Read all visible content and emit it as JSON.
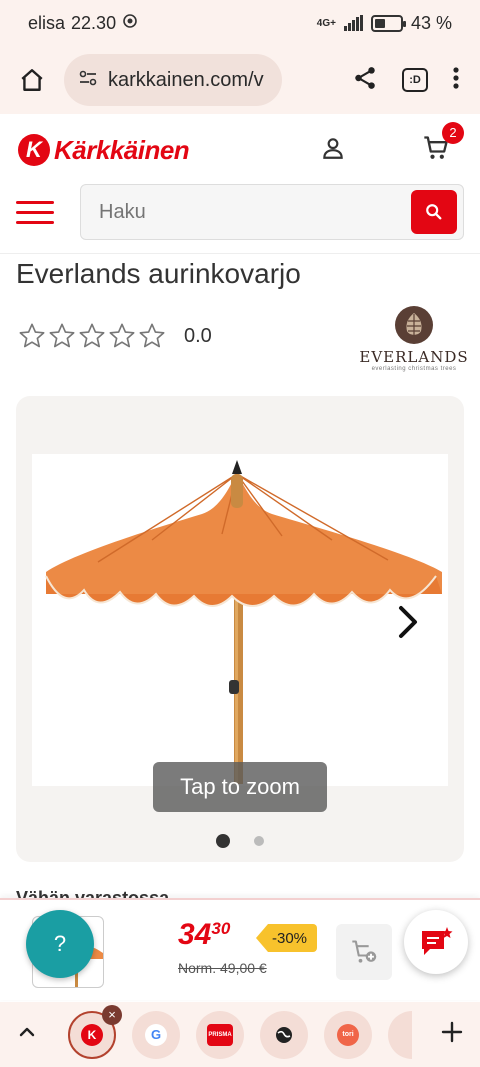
{
  "status_bar": {
    "carrier": "elisa",
    "time": "22.30",
    "network": "4G+",
    "battery_text": "43 %",
    "battery_level": 0.43
  },
  "browser": {
    "url": "karkkainen.com/v",
    "tab_count": ":D"
  },
  "site": {
    "brand_name": "Kärkkäinen",
    "cart_count": "2",
    "search": {
      "placeholder": "Haku"
    },
    "accent_color": "#e30613"
  },
  "product": {
    "title": "Everlands aurinkovarjo",
    "rating_value": "0.0",
    "rating_stars": 0,
    "brand_logo": {
      "name": "EVERLANDS",
      "tagline": "everlasting christmas trees"
    },
    "gallery": {
      "zoom_hint": "Tap to zoom",
      "image_count": 2,
      "active_index": 0
    },
    "peek_text": "Vähän varastossa"
  },
  "sticky_bar": {
    "help_label": "?",
    "price_main": "34",
    "price_cents": "30",
    "old_price": "Norm. 49,00 €",
    "discount": "-30%"
  },
  "tab_bar": {
    "tabs": [
      {
        "name": "karkkainen",
        "active": true
      },
      {
        "name": "google"
      },
      {
        "name": "prisma",
        "label": "PRISMA"
      },
      {
        "name": "globe"
      },
      {
        "name": "tori",
        "label": "tori"
      }
    ]
  }
}
